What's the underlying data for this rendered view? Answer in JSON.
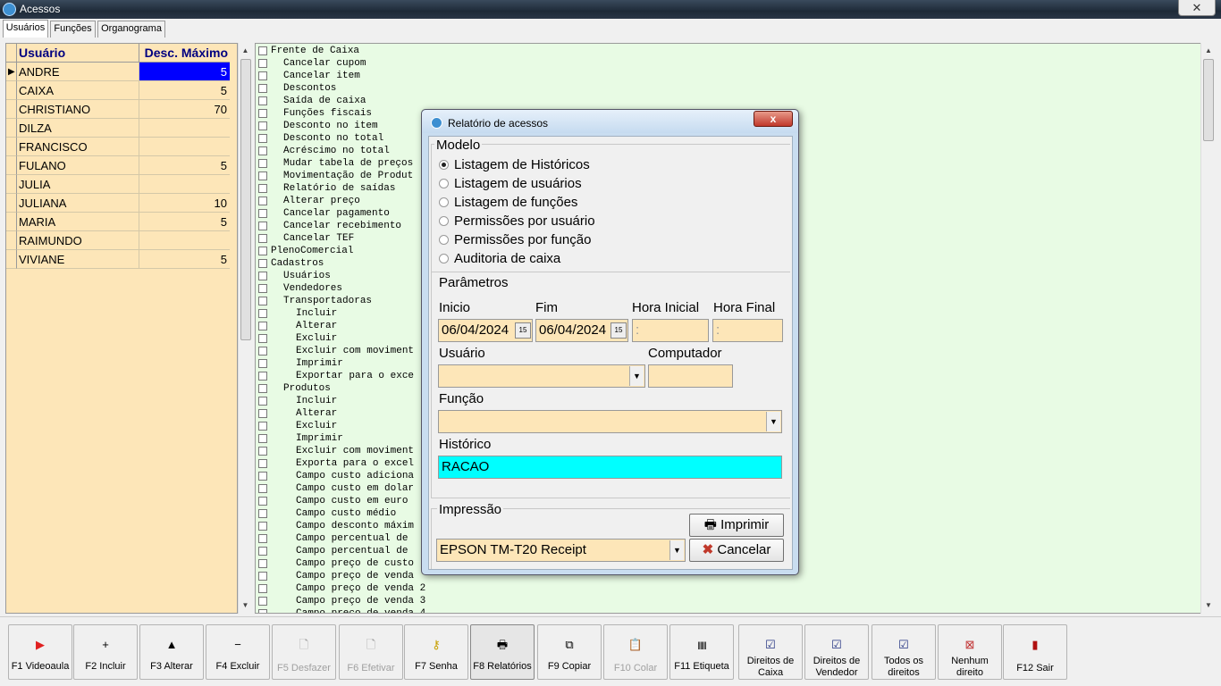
{
  "window": {
    "title": "Acessos"
  },
  "tabs": [
    {
      "label": "Usuários"
    },
    {
      "label": "Funções"
    },
    {
      "label": "Organograma"
    }
  ],
  "users_grid": {
    "headers": [
      "Usuário",
      "Desc. Máximo"
    ],
    "rows": [
      {
        "name": "ANDRE",
        "desc": "5"
      },
      {
        "name": "CAIXA",
        "desc": "5"
      },
      {
        "name": "CHRISTIANO",
        "desc": "70"
      },
      {
        "name": "DILZA",
        "desc": ""
      },
      {
        "name": "FRANCISCO",
        "desc": ""
      },
      {
        "name": "FULANO",
        "desc": "5"
      },
      {
        "name": "JULIA",
        "desc": ""
      },
      {
        "name": "JULIANA",
        "desc": "10"
      },
      {
        "name": "MARIA",
        "desc": "5"
      },
      {
        "name": "RAIMUNDO",
        "desc": ""
      },
      {
        "name": "VIVIANE",
        "desc": "5"
      }
    ],
    "selected_row": 0
  },
  "functions_tree": [
    {
      "label": "Frente de Caixa",
      "level": 0
    },
    {
      "label": "Cancelar cupom",
      "level": 1
    },
    {
      "label": "Cancelar item",
      "level": 1
    },
    {
      "label": "Descontos",
      "level": 1
    },
    {
      "label": "Saída de caixa",
      "level": 1
    },
    {
      "label": "Funções fiscais",
      "level": 1
    },
    {
      "label": "Desconto no item",
      "level": 1
    },
    {
      "label": "Desconto no total",
      "level": 1
    },
    {
      "label": "Acréscimo no total",
      "level": 1
    },
    {
      "label": "Mudar tabela de preços",
      "level": 1
    },
    {
      "label": "Movimentação de Produt",
      "level": 1
    },
    {
      "label": "Relatório de saídas",
      "level": 1
    },
    {
      "label": "Alterar preço",
      "level": 1
    },
    {
      "label": "Cancelar pagamento",
      "level": 1
    },
    {
      "label": "Cancelar recebimento",
      "level": 1
    },
    {
      "label": "Cancelar TEF",
      "level": 1
    },
    {
      "label": "PlenoComercial",
      "level": 0
    },
    {
      "label": "Cadastros",
      "level": 0
    },
    {
      "label": "Usuários",
      "level": 1
    },
    {
      "label": "Vendedores",
      "level": 1
    },
    {
      "label": "Transportadoras",
      "level": 1
    },
    {
      "label": "Incluir",
      "level": 2
    },
    {
      "label": "Alterar",
      "level": 2
    },
    {
      "label": "Excluir",
      "level": 2
    },
    {
      "label": "Excluir com moviment",
      "level": 2
    },
    {
      "label": "Imprimir",
      "level": 2
    },
    {
      "label": "Exportar para o exce",
      "level": 2
    },
    {
      "label": "Produtos",
      "level": 1
    },
    {
      "label": "Incluir",
      "level": 2
    },
    {
      "label": "Alterar",
      "level": 2
    },
    {
      "label": "Excluir",
      "level": 2
    },
    {
      "label": "Imprimir",
      "level": 2
    },
    {
      "label": "Excluir com moviment",
      "level": 2
    },
    {
      "label": "Exporta para o excel",
      "level": 2
    },
    {
      "label": "Campo custo adiciona",
      "level": 2
    },
    {
      "label": "Campo custo em dolar",
      "level": 2
    },
    {
      "label": "Campo custo em euro",
      "level": 2
    },
    {
      "label": "Campo custo médio",
      "level": 2
    },
    {
      "label": "Campo desconto máxim",
      "level": 2
    },
    {
      "label": "Campo percentual de",
      "level": 2
    },
    {
      "label": "Campo percentual de",
      "level": 2
    },
    {
      "label": "Campo preço de custo",
      "level": 2
    },
    {
      "label": "Campo preço de venda",
      "level": 2
    },
    {
      "label": "Campo preço de venda 2",
      "level": 2
    },
    {
      "label": "Campo preço de venda 3",
      "level": 2
    },
    {
      "label": "Campo preço de venda 4",
      "level": 2
    }
  ],
  "dialog": {
    "title": "Relatório de acessos",
    "close_label": "x",
    "modelo": {
      "label": "Modelo",
      "options": [
        "Listagem de Históricos",
        "Listagem de usuários",
        "Listagem de funções",
        "Permissões por usuário",
        "Permissões por função",
        "Auditoria de caixa"
      ],
      "selected": 0
    },
    "parametros": {
      "label": "Parâmetros",
      "inicio_label": "Inicio",
      "inicio_value": "06/04/2024",
      "fim_label": "Fim",
      "fim_value": "06/04/2024",
      "hora_inicial_label": "Hora Inicial",
      "hora_inicial_value": ":",
      "hora_final_label": "Hora Final",
      "hora_final_value": ":",
      "usuario_label": "Usuário",
      "usuario_value": "",
      "computador_label": "Computador",
      "computador_value": "",
      "funcao_label": "Função",
      "funcao_value": "",
      "historico_label": "Histórico",
      "historico_value": "RACAO"
    },
    "impressao": {
      "label": "Impressão",
      "printer": "EPSON TM-T20 Receipt",
      "imprimir_label": "Imprimir",
      "cancelar_label": "Cancelar"
    }
  },
  "toolbar": [
    {
      "label": "F1 Videoaula",
      "icon": "video-icon",
      "enabled": true
    },
    {
      "label": "F2 Incluir",
      "icon": "plus-icon",
      "enabled": true
    },
    {
      "label": "F3 Alterar",
      "icon": "up-arrow-icon",
      "enabled": true
    },
    {
      "label": "F4 Excluir",
      "icon": "minus-icon",
      "enabled": true
    },
    {
      "label": "F5 Desfazer",
      "icon": "document-icon",
      "enabled": false
    },
    {
      "label": "F6 Efetivar",
      "icon": "document-icon",
      "enabled": false
    },
    {
      "label": "F7 Senha",
      "icon": "key-icon",
      "enabled": true
    },
    {
      "label": "F8 Relatórios",
      "icon": "printer-icon",
      "enabled": true
    },
    {
      "label": "F9 Copiar",
      "icon": "copy-icon",
      "enabled": true
    },
    {
      "label": "F10 Colar",
      "icon": "paste-icon",
      "enabled": false
    },
    {
      "label": "F11 Etiqueta",
      "icon": "barcode-icon",
      "enabled": true
    },
    {
      "label": "Direitos de Caixa",
      "icon": "checklist-icon",
      "enabled": true
    },
    {
      "label": "Direitos de Vendedor",
      "icon": "checklist-icon",
      "enabled": true
    },
    {
      "label": "Todos os direitos",
      "icon": "checklist-icon",
      "enabled": true
    },
    {
      "label": "Nenhum direito",
      "icon": "no-rights-icon",
      "enabled": true
    },
    {
      "label": "F12 Sair",
      "icon": "exit-door-icon",
      "enabled": true
    }
  ],
  "colors": {
    "grid_bg": "#fde6b8",
    "selection": "#0000ff",
    "tree_bg": "#e8fbe4",
    "historico_bg": "#00ffff"
  }
}
